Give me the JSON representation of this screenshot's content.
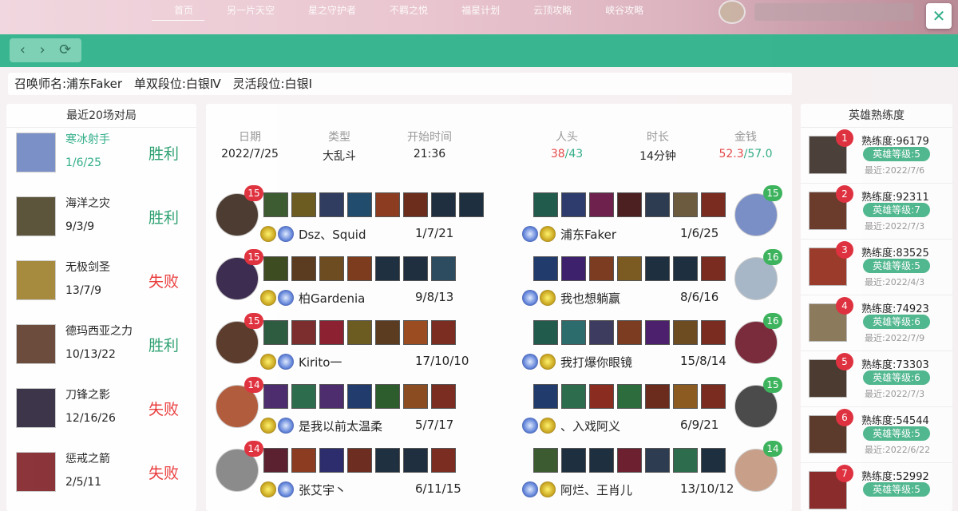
{
  "background_nav": {
    "items": [
      "首页",
      "另一片天空",
      "星之守护者",
      "不羁之悦",
      "福星计划",
      "云顶攻略",
      "峡谷攻略"
    ]
  },
  "close_glyph": "✕",
  "toolbar": {
    "back": "‹",
    "forward": "›",
    "refresh": "⟳"
  },
  "summoner": {
    "name": "召唤师名:浦东Faker",
    "solo_rank": "单双段位:白银Ⅳ",
    "flex_rank": "灵活段位:白银Ⅰ"
  },
  "recent": {
    "title": "最近20场对局",
    "matches": [
      {
        "champion": "寒冰射手",
        "kda": "1/6/25",
        "result": "胜利",
        "win": true,
        "highlight": true,
        "color": "#7a8fc8"
      },
      {
        "champion": "海洋之灾",
        "kda": "9/3/9",
        "result": "胜利",
        "win": true,
        "highlight": false,
        "color": "#5a5338"
      },
      {
        "champion": "无极剑圣",
        "kda": "13/7/9",
        "result": "失败",
        "win": false,
        "highlight": false,
        "color": "#a58a3c"
      },
      {
        "champion": "德玛西亚之力",
        "kda": "10/13/22",
        "result": "胜利",
        "win": true,
        "highlight": false,
        "color": "#6a4b3a"
      },
      {
        "champion": "刀锋之影",
        "kda": "12/16/26",
        "result": "失败",
        "win": false,
        "highlight": false,
        "color": "#3a3348"
      },
      {
        "champion": "惩戒之箭",
        "kda": "2/5/11",
        "result": "失败",
        "win": false,
        "highlight": false,
        "color": "#8a3238"
      }
    ]
  },
  "match": {
    "headers": [
      {
        "label": "日期",
        "value": "2022/7/25"
      },
      {
        "label": "类型",
        "value": "大乱斗"
      },
      {
        "label": "开始时间",
        "value": "21:36"
      },
      {
        "label": "人头",
        "value_a": "38",
        "value_b": "/43"
      },
      {
        "label": "时长",
        "value": "14分钟"
      },
      {
        "label": "金钱",
        "value_a": "52.3",
        "value_b": "/57.0"
      }
    ],
    "team_left": [
      {
        "name": "Dsz、Squid",
        "kda": "1/7/21",
        "level": "15",
        "color": "#4a3a2e",
        "highlight": false,
        "items": [
          "#3b5a2e",
          "#6b5a1e",
          "#2d3a5e",
          "#1e4a6b",
          "#8b3a1e",
          "#6a2a1a",
          "#1b2d3e",
          "#1b2d3e"
        ]
      },
      {
        "name": "柏Gardenia",
        "kda": "9/8/13",
        "level": "15",
        "color": "#3a2a4e",
        "highlight": false,
        "items": [
          "#3a4a1e",
          "#5a3a1e",
          "#6b4a1e",
          "#7a3a1a",
          "#1b2d3e",
          "#1b2d3e",
          "#2a4a5e"
        ]
      },
      {
        "name": "Kirito一",
        "kda": "17/10/10",
        "level": "15",
        "color": "#5a3a2a",
        "highlight": false,
        "items": [
          "#2a5a3e",
          "#7a2a2a",
          "#8a1e2e",
          "#6b5a1e",
          "#5a3a1e",
          "#9a4a1e",
          "#7a2a1e"
        ]
      },
      {
        "name": "是我以前太温柔",
        "kda": "5/7/17",
        "level": "14",
        "color": "#b05a3a",
        "highlight": false,
        "items": [
          "#4a2a6b",
          "#2a6b4a",
          "#4a2a6b",
          "#1e3a6b",
          "#2a5a2a",
          "#8a4a1e",
          "#7a2a1e"
        ]
      },
      {
        "name": "张艾宇丶",
        "kda": "6/11/15",
        "level": "14",
        "color": "#8a8a8a",
        "highlight": false,
        "items": [
          "#5a1e2e",
          "#8a3a1e",
          "#2a2a6b",
          "#6b2a1e",
          "#1b2d3e",
          "#1b2d3e",
          "#7a2a1e"
        ]
      }
    ],
    "team_right": [
      {
        "name": "浦东Faker",
        "kda": "1/6/25",
        "level": "15",
        "color": "#7a8fc8",
        "highlight": true,
        "items": [
          "#1e5a4a",
          "#2a3a6b",
          "#6b1e4a",
          "#4a1e1e",
          "#2a3a4e",
          "#6b5a3e",
          "#7a2a1e"
        ]
      },
      {
        "name": "我也想躺赢",
        "kda": "8/6/16",
        "level": "16",
        "color": "#a8b8c8",
        "highlight": false,
        "items": [
          "#1e3a6b",
          "#3a1e6b",
          "#7a3a1e",
          "#7a5a1e",
          "#1b2d3e",
          "#1b2d3e",
          "#7a2a1e"
        ]
      },
      {
        "name": "我打爆你眼镜",
        "kda": "15/8/14",
        "level": "16",
        "color": "#7a2a3a",
        "highlight": false,
        "items": [
          "#1e5a4a",
          "#2a6b6b",
          "#3a3a5e",
          "#7a3a1e",
          "#4a1e6b",
          "#6b4a1e",
          "#7a2a1e"
        ]
      },
      {
        "name": "、入戏阿义",
        "kda": "6/9/21",
        "level": "15",
        "color": "#4a4a4a",
        "highlight": false,
        "items": [
          "#1e3a6b",
          "#2a6b4a",
          "#8a2a1e",
          "#2a6b3a",
          "#6a2a1a",
          "#8a5a1e",
          "#7a2a1e"
        ]
      },
      {
        "name": "阿烂、王肖儿",
        "kda": "13/10/12",
        "level": "14",
        "color": "#c8a08a",
        "highlight": false,
        "items": [
          "#3a5a2e",
          "#1b2d3e",
          "#1b2d3e",
          "#6b1e2e",
          "#2a3a4e",
          "#2a6b4a",
          "#1b2d3e"
        ]
      }
    ]
  },
  "mastery": {
    "title": "英雄熟练度",
    "items": [
      {
        "rank": "1",
        "points": "熟练度:96179",
        "level": "英雄等级:5",
        "last": "最近:2022/7/6",
        "color": "#4a4038"
      },
      {
        "rank": "2",
        "points": "熟练度:92311",
        "level": "英雄等级:7",
        "last": "最近:2022/7/3",
        "color": "#6a3a2a"
      },
      {
        "rank": "3",
        "points": "熟练度:83525",
        "level": "英雄等级:5",
        "last": "最近:2022/4/3",
        "color": "#9a3a2a"
      },
      {
        "rank": "4",
        "points": "熟练度:74923",
        "level": "英雄等级:6",
        "last": "最近:2022/7/9",
        "color": "#8a7a5a"
      },
      {
        "rank": "5",
        "points": "熟练度:73303",
        "level": "英雄等级:6",
        "last": "最近:2022/7/3",
        "color": "#4a3a2e"
      },
      {
        "rank": "6",
        "points": "熟练度:54544",
        "level": "英雄等级:5",
        "last": "最近:2022/6/22",
        "color": "#5a3a2a"
      },
      {
        "rank": "7",
        "points": "熟练度:52992",
        "level": "英雄等级:5",
        "last": "",
        "color": "#8a2a2a"
      }
    ]
  }
}
